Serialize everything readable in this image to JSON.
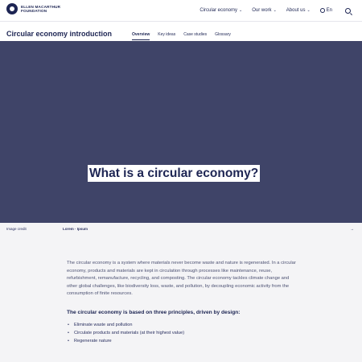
{
  "brand": {
    "line1": "ELLEN MACARTHUR",
    "line2": "FOUNDATION"
  },
  "nav": {
    "items": [
      {
        "label": "Circular economy",
        "chevron": "⌄"
      },
      {
        "label": "Our work",
        "chevron": "⌄"
      },
      {
        "label": "About us",
        "chevron": "⌄"
      }
    ],
    "language": "En"
  },
  "subnav": {
    "title": "Circular economy introduction",
    "tabs": [
      "Overview",
      "Key ideas",
      "Case studies",
      "Glossary"
    ],
    "active_tab": 0
  },
  "hero": {
    "title": "What is a circular economy?",
    "background": "#3f4468"
  },
  "credit": {
    "left": "Image credit",
    "middle": "Lorem · Ipsum",
    "right": "→"
  },
  "content": {
    "intro": "The circular economy is a system where materials never become waste and nature is regenerated. In a circular economy, products and materials are kept in circulation through processes like maintenance, reuse, refurbishment, remanufacture, recycling, and composting. The circular economy tackles climate change and other global challenges, like biodiversity loss, waste, and pollution, by decoupling economic activity from the consumption of finite resources.",
    "principles_heading": "The circular economy is based on three principles, driven by design:",
    "principles": [
      "Eliminate waste and pollution",
      "Circulate products and materials (at their highest value)",
      "Regenerate nature"
    ]
  }
}
